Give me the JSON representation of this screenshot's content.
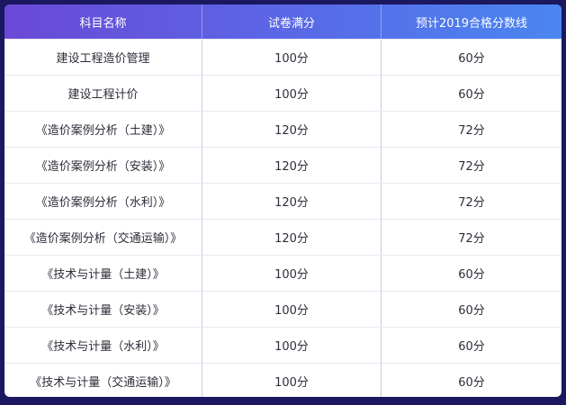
{
  "table": {
    "headers": [
      "科目名称",
      "试卷满分",
      "预计2019合格分数线"
    ],
    "rows": [
      [
        "建设工程造价管理",
        "100分",
        "60分"
      ],
      [
        "建设工程计价",
        "100分",
        "60分"
      ],
      [
        "《造价案例分析（土建）》",
        "120分",
        "72分"
      ],
      [
        "《造价案例分析（安装）》",
        "120分",
        "72分"
      ],
      [
        "《造价案例分析（水利）》",
        "120分",
        "72分"
      ],
      [
        "《造价案例分析（交通运输）》",
        "120分",
        "72分"
      ],
      [
        "《技术与计量（土建）》",
        "100分",
        "60分"
      ],
      [
        "《技术与计量（安装）》",
        "100分",
        "60分"
      ],
      [
        "《技术与计量（水利）》",
        "100分",
        "60分"
      ],
      [
        "《技术与计量（交通运输）》",
        "100分",
        "60分"
      ]
    ]
  },
  "colors": {
    "page_background": "#1b1860",
    "header_gradient_start": "#6a49d6",
    "header_gradient_end": "#4a86f0",
    "cell_background": "#ffffff",
    "text": "#2d2d3a"
  }
}
